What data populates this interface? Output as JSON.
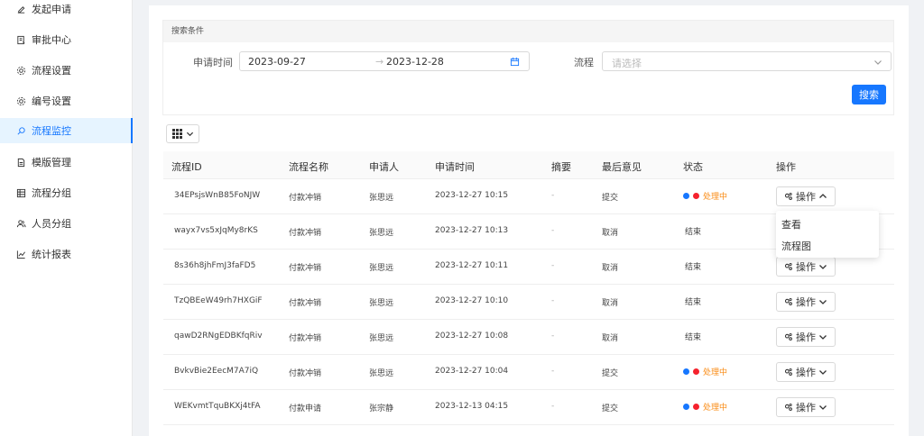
{
  "sidebar": {
    "items": [
      {
        "label": "发起申请",
        "icon": "edit-icon"
      },
      {
        "label": "审批中心",
        "icon": "approval-icon"
      },
      {
        "label": "流程设置",
        "icon": "settings-icon"
      },
      {
        "label": "编号设置",
        "icon": "settings-icon"
      },
      {
        "label": "流程监控",
        "icon": "monitor-icon",
        "active": true
      },
      {
        "label": "模版管理",
        "icon": "template-icon"
      },
      {
        "label": "流程分组",
        "icon": "group-icon"
      },
      {
        "label": "人员分组",
        "icon": "users-icon"
      },
      {
        "label": "统计报表",
        "icon": "chart-icon"
      }
    ]
  },
  "search": {
    "header": "搜索条件",
    "date_label": "申请时间",
    "date_start": "2023-09-27",
    "date_sep": "→",
    "date_end": "2023-12-28",
    "flow_label": "流程",
    "flow_placeholder": "请选择",
    "search_button": "搜索"
  },
  "table": {
    "columns": [
      "流程ID",
      "流程名称",
      "申请人",
      "申请时间",
      "摘要",
      "最后意见",
      "状态",
      "操作"
    ],
    "rows": [
      {
        "id": "34EPsjsWnB85FoNJW",
        "name": "付款冲销",
        "applicant": "张思远",
        "time": "2023-12-27 10:15",
        "summary": "-",
        "opinion": "提交",
        "status": "处理中",
        "processing": true,
        "op": "操作",
        "expanded": true
      },
      {
        "id": "wayx7vs5xJqMy8rKS",
        "name": "付款冲销",
        "applicant": "张思远",
        "time": "2023-12-27 10:13",
        "summary": "-",
        "opinion": "取消",
        "status": "结束",
        "processing": false,
        "op": "操作"
      },
      {
        "id": "8s36h8jhFmJ3faFD5",
        "name": "付款冲销",
        "applicant": "张思远",
        "time": "2023-12-27 10:11",
        "summary": "-",
        "opinion": "取消",
        "status": "结束",
        "processing": false,
        "op": "操作"
      },
      {
        "id": "TzQBEeW49rh7HXGiF",
        "name": "付款冲销",
        "applicant": "张思远",
        "time": "2023-12-27 10:10",
        "summary": "-",
        "opinion": "取消",
        "status": "结束",
        "processing": false,
        "op": "操作"
      },
      {
        "id": "qawD2RNgEDBKfqRiv",
        "name": "付款冲销",
        "applicant": "张思远",
        "time": "2023-12-27 10:08",
        "summary": "-",
        "opinion": "取消",
        "status": "结束",
        "processing": false,
        "op": "操作"
      },
      {
        "id": "BvkvBie2EecM7A7iQ",
        "name": "付款冲销",
        "applicant": "张思远",
        "time": "2023-12-27 10:04",
        "summary": "-",
        "opinion": "提交",
        "status": "处理中",
        "processing": true,
        "op": "操作"
      },
      {
        "id": "WEKvmtTquBKXj4tFA",
        "name": "付款申请",
        "applicant": "张宗静",
        "time": "2023-12-13 04:15",
        "summary": "-",
        "opinion": "提交",
        "status": "处理中",
        "processing": true,
        "op": "操作"
      }
    ]
  },
  "dropdown": {
    "items": [
      "查看",
      "流程图"
    ]
  },
  "colors": {
    "primary": "#1677ff",
    "processing": "#fa8c16",
    "red": "#f5222d"
  }
}
